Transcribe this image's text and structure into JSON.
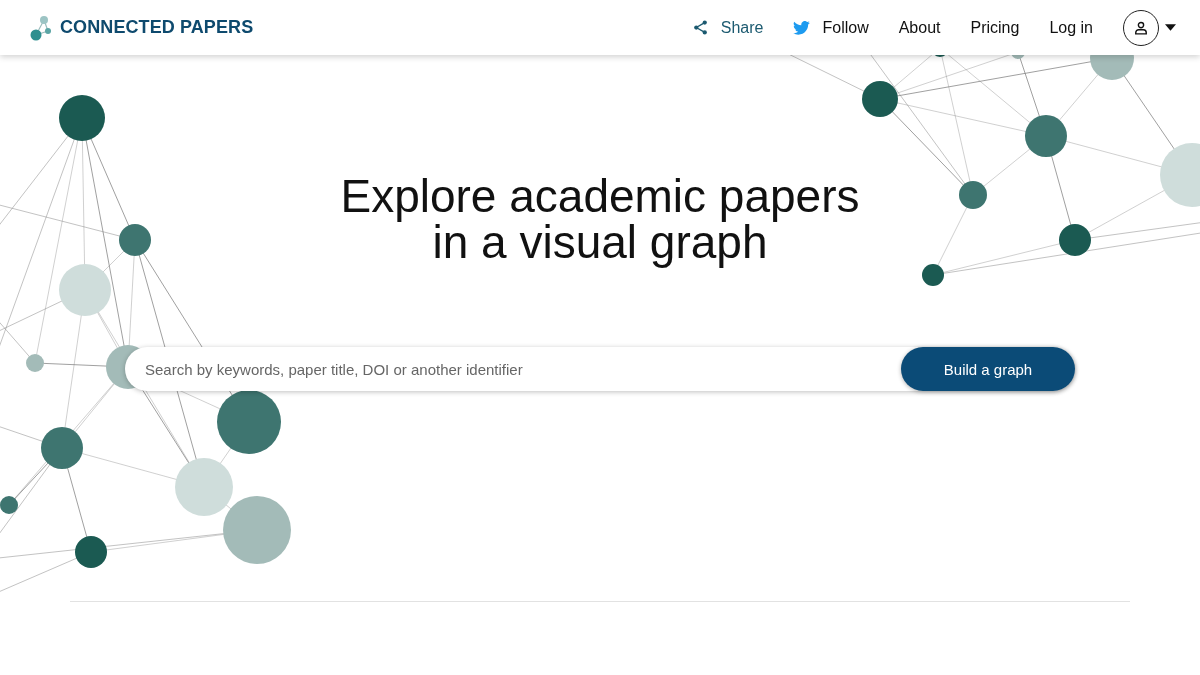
{
  "header": {
    "brand": "CONNECTED PAPERS",
    "nav": [
      {
        "kind": "share",
        "label": "Share"
      },
      {
        "kind": "follow",
        "label": "Follow"
      },
      {
        "kind": "link",
        "label": "About"
      },
      {
        "kind": "link",
        "label": "Pricing"
      },
      {
        "kind": "link",
        "label": "Log in"
      }
    ]
  },
  "hero": {
    "title_lines": [
      "Explore academic papers",
      "in a visual graph"
    ],
    "search": {
      "placeholder": "Search by keywords, paper title, DOI or another identifier"
    },
    "button": "Build a graph"
  }
}
